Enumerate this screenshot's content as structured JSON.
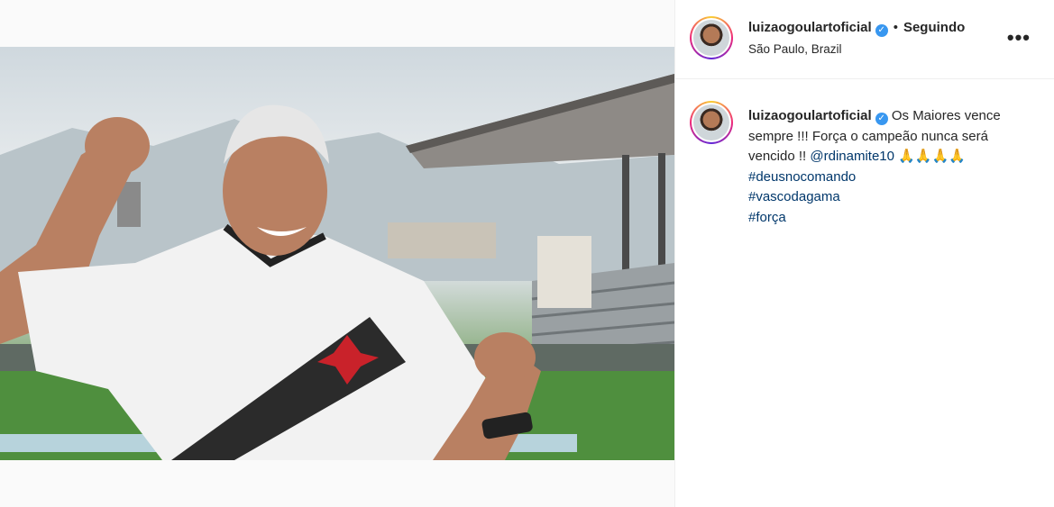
{
  "post": {
    "username": "luizaogoulartoficial",
    "verified_mark": "✓",
    "separator": "•",
    "follow_status": "Seguindo",
    "location": "São Paulo, Brazil",
    "more_icon": "more-options-icon",
    "more_glyph": "•••"
  },
  "caption": {
    "username": "luizaogoulartoficial",
    "text_before_mention": " Os Maiores vence sempre !!! Força o campeão nunca será vencido !! ",
    "mention": "@rdinamite10",
    "emojis": " 🙏🙏🙏🙏",
    "hashtags": [
      "#deusnocomando",
      "#vascodagama",
      "#força"
    ]
  },
  "colors": {
    "link": "#00376b",
    "verified": "#3897f0",
    "text": "#262626",
    "divider": "#efefef"
  }
}
